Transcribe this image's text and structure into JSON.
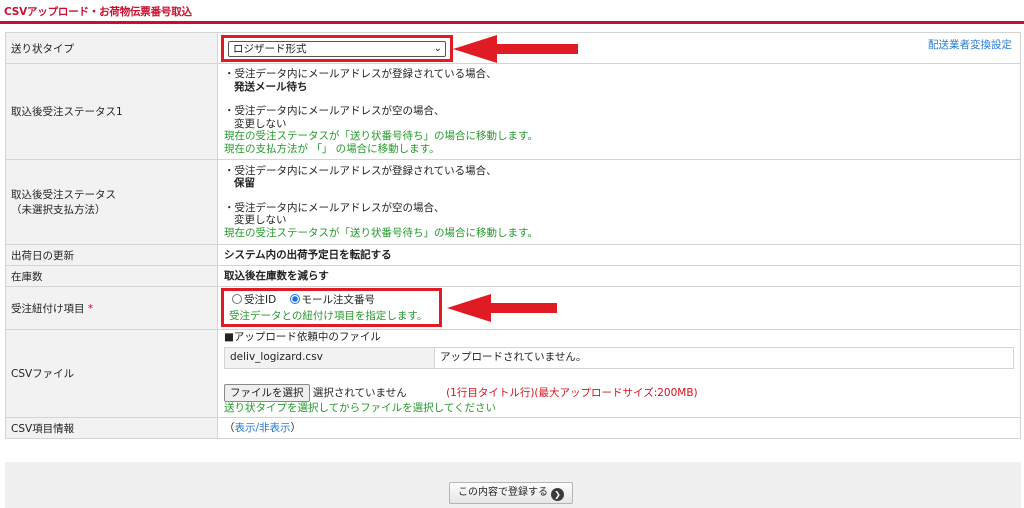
{
  "page_title": "CSVアップロード・お荷物伝票番号取込",
  "colors": {
    "accent_red": "#c8102e",
    "arrow_red": "#e01b23",
    "hint_green": "#259a2b",
    "link_blue": "#2a7bd1"
  },
  "rows": {
    "slip_type": {
      "label": "送り状タイプ",
      "selected": "ロジザード形式",
      "config_link": "配送業者変換設定"
    },
    "status1": {
      "label": "取込後受注ステータス1",
      "line1": "・受注データ内にメールアドレスが登録されている場合、",
      "line1_value": "発送メール待ち",
      "line2": "・受注データ内にメールアドレスが空の場合、",
      "line2_value": "変更しない",
      "note1": "現在の受注ステータスが「送り状番号待ち」の場合に移動します。",
      "note2": "現在の支払方法が 「」 の場合に移動します。"
    },
    "status2": {
      "label_line1": "取込後受注ステータス",
      "label_line2": "（未選択支払方法）",
      "line1": "・受注データ内にメールアドレスが登録されている場合、",
      "line1_value": "保留",
      "line2": "・受注データ内にメールアドレスが空の場合、",
      "line2_value": "変更しない",
      "note1": "現在の受注ステータスが「送り状番号待ち」の場合に移動します。"
    },
    "ship_date": {
      "label": "出荷日の更新",
      "value": "システム内の出荷予定日を転記する"
    },
    "stock": {
      "label": "在庫数",
      "value": "取込後在庫数を減らす"
    },
    "link_item": {
      "label": "受注紐付け項目",
      "required_mark": "*",
      "option1": "受注ID",
      "option2": "モール注文番号",
      "selected": "モール注文番号",
      "hint": "受注データとの紐付け項目を指定します。"
    },
    "csv_file": {
      "label": "CSVファイル",
      "pending_heading": "■アップロード依頼中のファイル",
      "pending_file": "deliv_logizard.csv",
      "pending_status": "アップロードされていません。",
      "choose_button": "ファイルを選択",
      "no_file": "選択されていません",
      "limit_note": "(1行目タイトル行)(最大アップロードサイズ:200MB)",
      "hint": "送り状タイプを選択してからファイルを選択してください"
    },
    "csv_info": {
      "label": "CSV項目情報",
      "open_paren": "（",
      "toggle": "表示/非表示",
      "close_paren": "）"
    }
  },
  "submit_label": "この内容で登録する",
  "icons": {
    "select_chevron": "chevron-down-icon",
    "submit_go": "circle-arrow-right-icon",
    "annotation_arrow": "red-arrow-left-icon"
  }
}
